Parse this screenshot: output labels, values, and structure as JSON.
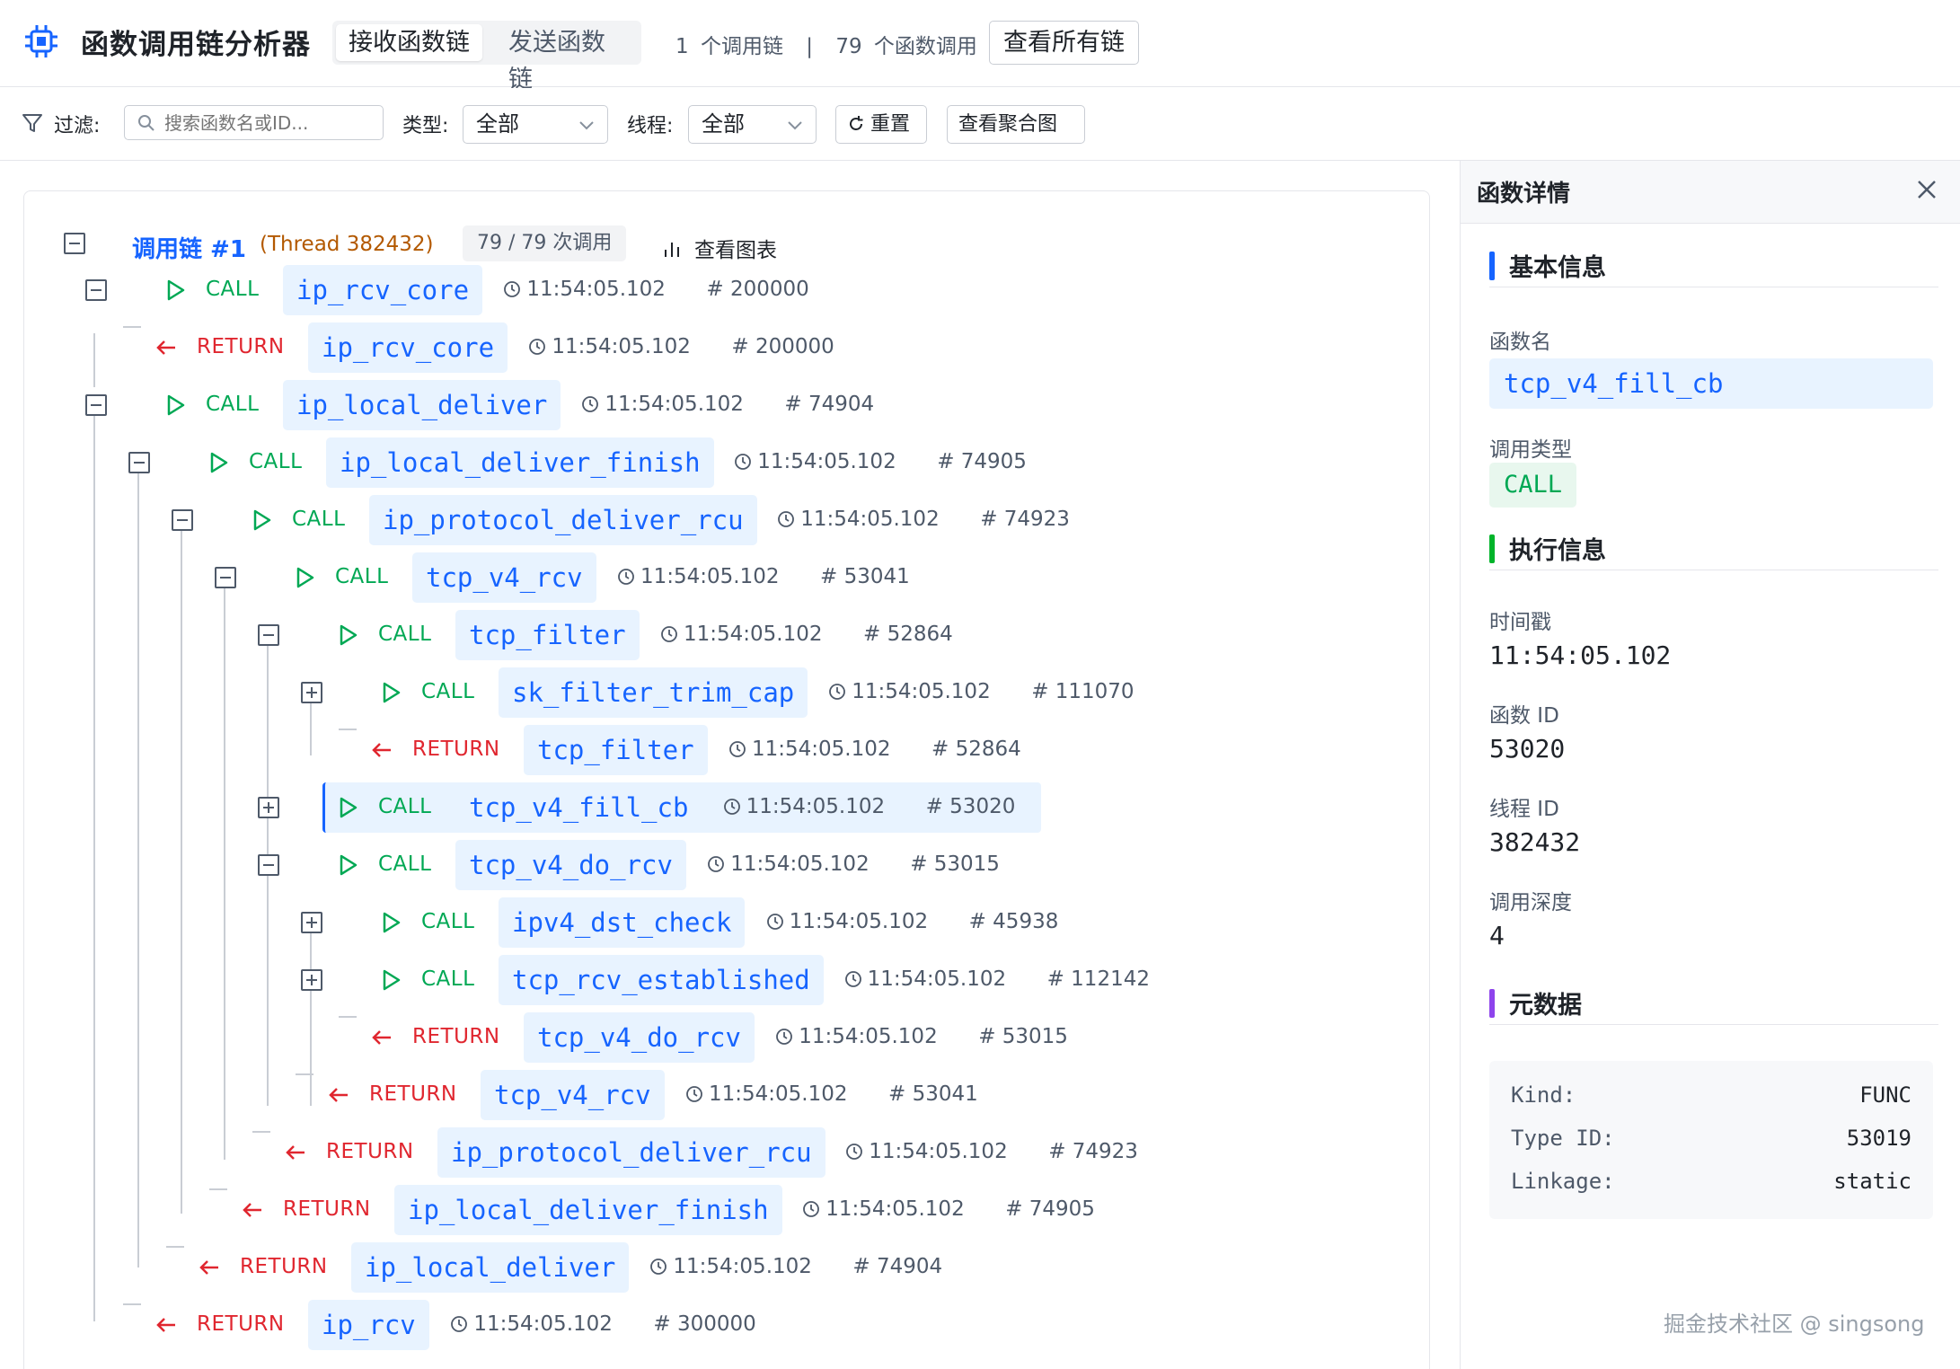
{
  "header": {
    "title": "函数调用链分析器",
    "tabs": [
      {
        "label": "接收函数链",
        "active": true
      },
      {
        "label": "发送函数链",
        "active": false
      }
    ],
    "chain_count": "1",
    "chain_unit": "个调用链",
    "separator": "|",
    "call_count": "79",
    "call_unit": "个函数调用",
    "view_all_label": "查看所有链"
  },
  "filter": {
    "label": "过滤:",
    "search_placeholder": "搜索函数名或ID...",
    "type_label": "类型:",
    "type_value": "全部",
    "thread_label": "线程:",
    "thread_value": "全部",
    "reset_label": "重置",
    "aggregate_label": "查看聚合图"
  },
  "chain": {
    "title": "调用链 #1",
    "thread": "(Thread 382432)",
    "count": "79 / 79 次调用",
    "chart_label": "查看图表"
  },
  "rows": [
    {
      "kind": "CALL",
      "fn": "ip_rcv_core",
      "ts": "11:54:05.102",
      "id": "# 200000",
      "depth": 0,
      "toggle": "minus"
    },
    {
      "kind": "RETURN",
      "fn": "ip_rcv_core",
      "ts": "11:54:05.102",
      "id": "# 200000",
      "depth": 0
    },
    {
      "kind": "CALL",
      "fn": "ip_local_deliver",
      "ts": "11:54:05.102",
      "id": "# 74904",
      "depth": 0,
      "toggle": "minus"
    },
    {
      "kind": "CALL",
      "fn": "ip_local_deliver_finish",
      "ts": "11:54:05.102",
      "id": "# 74905",
      "depth": 1,
      "toggle": "minus"
    },
    {
      "kind": "CALL",
      "fn": "ip_protocol_deliver_rcu",
      "ts": "11:54:05.102",
      "id": "# 74923",
      "depth": 2,
      "toggle": "minus"
    },
    {
      "kind": "CALL",
      "fn": "tcp_v4_rcv",
      "ts": "11:54:05.102",
      "id": "# 53041",
      "depth": 3,
      "toggle": "minus"
    },
    {
      "kind": "CALL",
      "fn": "tcp_filter",
      "ts": "11:54:05.102",
      "id": "# 52864",
      "depth": 4,
      "toggle": "minus"
    },
    {
      "kind": "CALL",
      "fn": "sk_filter_trim_cap",
      "ts": "11:54:05.102",
      "id": "# 111070",
      "depth": 5,
      "toggle": "plus"
    },
    {
      "kind": "RETURN",
      "fn": "tcp_filter",
      "ts": "11:54:05.102",
      "id": "# 52864",
      "depth": 5
    },
    {
      "kind": "CALL",
      "fn": "tcp_v4_fill_cb",
      "ts": "11:54:05.102",
      "id": "# 53020",
      "depth": 4,
      "toggle": "plus",
      "selected": true
    },
    {
      "kind": "CALL",
      "fn": "tcp_v4_do_rcv",
      "ts": "11:54:05.102",
      "id": "# 53015",
      "depth": 4,
      "toggle": "minus"
    },
    {
      "kind": "CALL",
      "fn": "ipv4_dst_check",
      "ts": "11:54:05.102",
      "id": "# 45938",
      "depth": 5,
      "toggle": "plus"
    },
    {
      "kind": "CALL",
      "fn": "tcp_rcv_established",
      "ts": "11:54:05.102",
      "id": "# 112142",
      "depth": 5,
      "toggle": "plus"
    },
    {
      "kind": "RETURN",
      "fn": "tcp_v4_do_rcv",
      "ts": "11:54:05.102",
      "id": "# 53015",
      "depth": 5
    },
    {
      "kind": "RETURN",
      "fn": "tcp_v4_rcv",
      "ts": "11:54:05.102",
      "id": "# 53041",
      "depth": 4
    },
    {
      "kind": "RETURN",
      "fn": "ip_protocol_deliver_rcu",
      "ts": "11:54:05.102",
      "id": "# 74923",
      "depth": 3
    },
    {
      "kind": "RETURN",
      "fn": "ip_local_deliver_finish",
      "ts": "11:54:05.102",
      "id": "# 74905",
      "depth": 2
    },
    {
      "kind": "RETURN",
      "fn": "ip_local_deliver",
      "ts": "11:54:05.102",
      "id": "# 74904",
      "depth": 1
    },
    {
      "kind": "RETURN",
      "fn": "ip_rcv",
      "ts": "11:54:05.102",
      "id": "# 300000",
      "depth": 0
    }
  ],
  "details": {
    "title": "函数详情",
    "basic_title": "基本信息",
    "fn_label": "函数名",
    "fn_value": "tcp_v4_fill_cb",
    "type_label": "调用类型",
    "type_value": "CALL",
    "exec_title": "执行信息",
    "ts_label": "时间戳",
    "ts_value": "11:54:05.102",
    "id_label": "函数 ID",
    "id_value": "53020",
    "thread_label": "线程 ID",
    "thread_value": "382432",
    "depth_label": "调用深度",
    "depth_value": "4",
    "meta_title": "元数据",
    "meta": [
      {
        "key": "Kind:",
        "value": "FUNC"
      },
      {
        "key": "Type ID:",
        "value": "53019"
      },
      {
        "key": "Linkage:",
        "value": "static"
      }
    ]
  },
  "watermark": "掘金技术社区 @ singsong",
  "colors": {
    "accent": "#1664ff",
    "call": "#00a854",
    "return": "#e0262f",
    "thread": "#b35900",
    "exec_bar": "#00b42a",
    "meta_bar": "#8e44ec"
  }
}
